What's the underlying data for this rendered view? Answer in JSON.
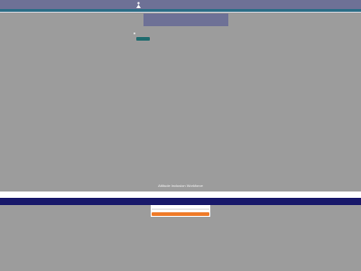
{
  "header": {
    "logo_icon": "person-logo-icon",
    "colors": {
      "bar": "#6e7196",
      "accent_line": "#2b6d86"
    }
  },
  "sidenav": {
    "items": [
      {
        "label": "",
        "active": true
      },
      {
        "label": "",
        "active": false
      },
      {
        "label": "",
        "active": false
      },
      {
        "label": "",
        "active": false
      },
      {
        "label": "",
        "active": false
      },
      {
        "label": "",
        "active": false
      },
      {
        "label": "",
        "active": false
      }
    ]
  },
  "main": {
    "panel_color": "#6e7196",
    "continue_label": "",
    "button_color": "#1f6b6e"
  },
  "footer": {
    "title": "Attitude Inclusion Workforce",
    "subtitle": "",
    "band_label": "",
    "navy_label": "",
    "navy_color": "#19196a"
  },
  "signup": {
    "email_placeholder": "",
    "subscribe_label": "",
    "subscribe_color": "#ef7a28"
  }
}
